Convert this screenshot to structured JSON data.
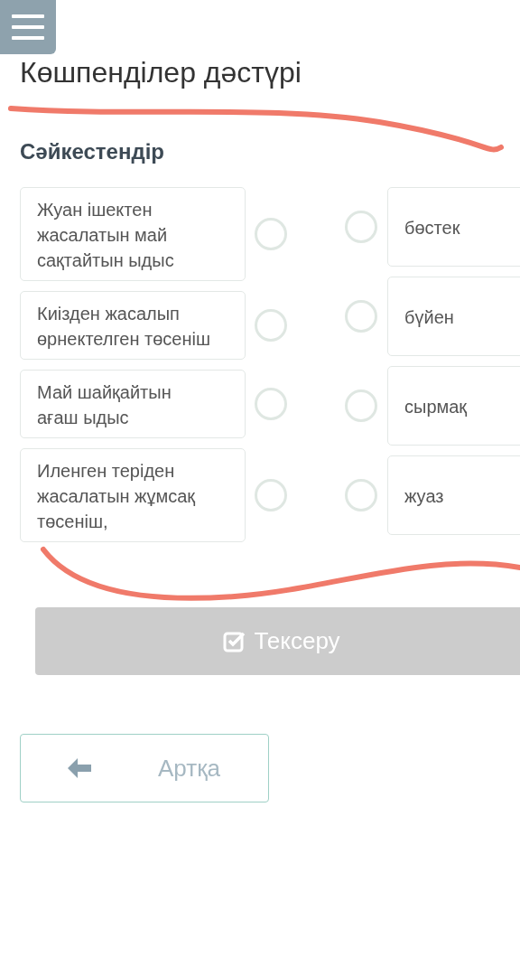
{
  "title": "Көшпенділер дәстүрі",
  "heading": "Сәйкестендір",
  "left_items": [
    {
      "text": "Жуан ішектен жасалатын май сақтайтын ыдыс"
    },
    {
      "text": "Киізден жасалып өрнектелген төсеніш"
    },
    {
      "text": "Май шайқайтын ағаш ыдыс"
    },
    {
      "text": "Иленген теріден жасалатын жұмсақ төсеніш,"
    }
  ],
  "right_items": [
    {
      "text": "бөстек"
    },
    {
      "text": "бүйен"
    },
    {
      "text": "сырмақ"
    },
    {
      "text": "жуаз"
    }
  ],
  "check_button": {
    "label": "Тексеру",
    "disabled": true
  },
  "back_button": {
    "label": "Артқа"
  }
}
